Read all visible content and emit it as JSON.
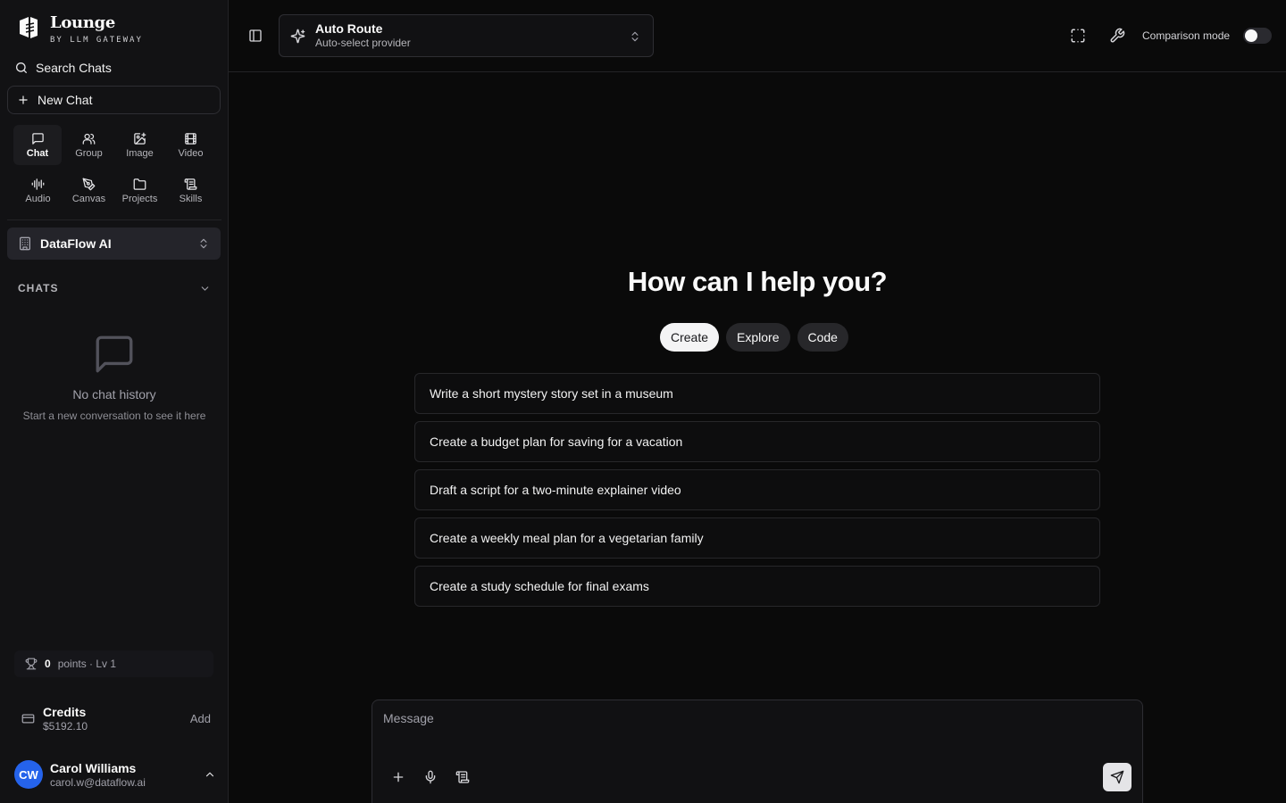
{
  "brand": {
    "title": "Lounge",
    "subtitle": "BY LLM GATEWAY",
    "icon": "lounge-logo-icon"
  },
  "sidebar": {
    "search_label": "Search Chats",
    "new_chat_label": "New Chat",
    "modes": [
      {
        "label": "Chat",
        "icon": "message-square-icon",
        "active": true
      },
      {
        "label": "Group",
        "icon": "users-icon"
      },
      {
        "label": "Image",
        "icon": "image-plus-icon"
      },
      {
        "label": "Video",
        "icon": "film-icon"
      },
      {
        "label": "Audio",
        "icon": "audio-lines-icon"
      },
      {
        "label": "Canvas",
        "icon": "pen-tool-icon"
      },
      {
        "label": "Projects",
        "icon": "folder-icon"
      },
      {
        "label": "Skills",
        "icon": "scroll-icon"
      }
    ],
    "org_name": "DataFlow AI",
    "chats_header": "CHATS",
    "empty_title": "No chat history",
    "empty_subtitle": "Start a new conversation to see it here",
    "points_value": "0",
    "points_label": "points · Lv 1",
    "credits_title": "Credits",
    "credits_value": "$5192.10",
    "credits_add": "Add",
    "user": {
      "initials": "CW",
      "name": "Carol Williams",
      "email": "carol.w@dataflow.ai"
    }
  },
  "header": {
    "model_name": "Auto Route",
    "model_desc": "Auto-select provider",
    "comparison_label": "Comparison mode",
    "comparison_on": false
  },
  "main": {
    "heading": "How can I help you?",
    "tabs": [
      {
        "label": "Create",
        "active": true
      },
      {
        "label": "Explore"
      },
      {
        "label": "Code"
      }
    ],
    "suggestions": [
      "Write a short mystery story set in a museum",
      "Create a budget plan for saving for a vacation",
      "Draft a script for a two-minute explainer video",
      "Create a weekly meal plan for a vegetarian family",
      "Create a study schedule for final exams"
    ]
  },
  "composer": {
    "placeholder": "Message"
  },
  "colors": {
    "background": "#0a0a0a",
    "sidebar": "#121214",
    "avatar": "#2563eb",
    "accent_light": "#f4f4f5"
  }
}
